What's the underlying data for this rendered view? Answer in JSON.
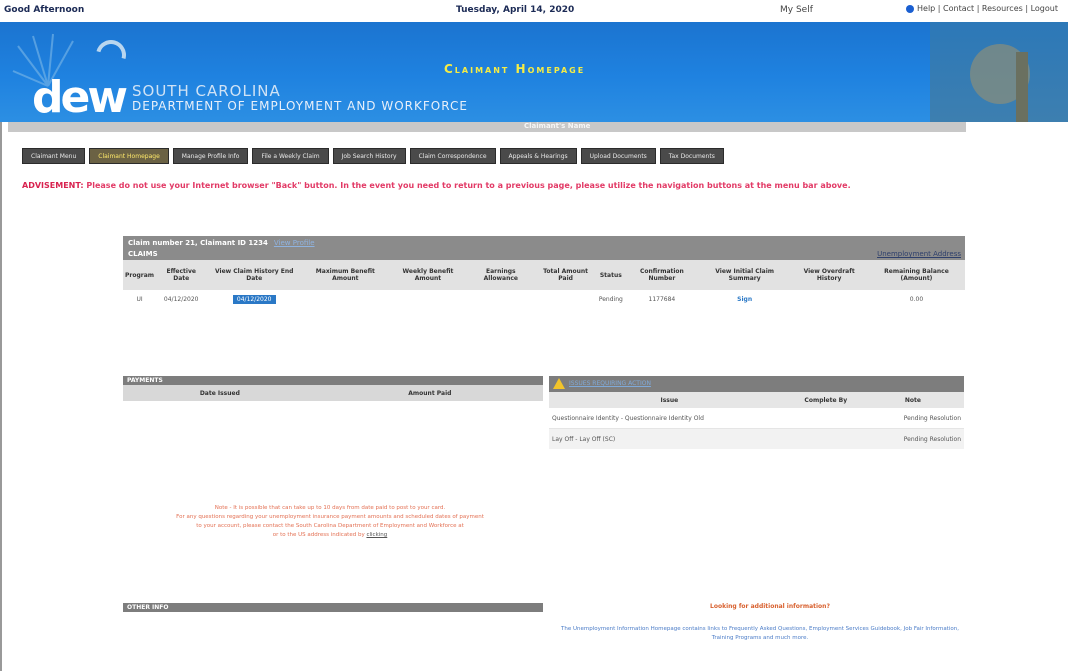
{
  "topbar": {
    "greeting": "Good Afternoon",
    "date": "Tuesday, April 14, 2020",
    "account": "My Self",
    "links": "Help | Contact | Resources | Logout"
  },
  "banner": {
    "logo": "dew",
    "state": "SOUTH CAROLINA",
    "department": "DEPARTMENT OF EMPLOYMENT AND WORKFORCE",
    "page_title": "Claimant Homepage",
    "claimant_name": "Claimant's Name"
  },
  "nav": {
    "tabs": [
      "Claimant Menu",
      "Claimant Homepage",
      "Manage Profile Info",
      "File a Weekly Claim",
      "Job Search History",
      "Claim Correspondence",
      "Appeals & Hearings",
      "Upload Documents",
      "Tax Documents"
    ]
  },
  "advice": {
    "label": "ADVISEMENT:",
    "text": "Please do not use your Internet browser \"Back\" button. In the event you need to return to a previous page, please utilize the navigation buttons at the menu bar above."
  },
  "claims": {
    "header_line1": "Claim number 21, Claimant ID 1234",
    "header_link": "View Profile",
    "header_line2": "CLAIMS",
    "right_link": "Unemployment Address",
    "columns": [
      "Program",
      "Effective Date",
      "View Claim History End Date",
      "Maximum Benefit Amount",
      "Weekly Benefit Amount",
      "Earnings Allowance",
      "Total Amount Paid",
      "Status",
      "Confirmation Number",
      "View Initial Claim Summary",
      "View Overdraft History",
      "Remaining Balance (Amount)"
    ],
    "row": {
      "program": "UI",
      "effective_date": "04/12/2020",
      "history_button": "04/12/2020",
      "max_benefit": "",
      "weekly_benefit": "",
      "earnings": "",
      "total_paid": "",
      "status": "Pending",
      "confirmation": "1177684",
      "summary_link": "Sign",
      "overdraft": "",
      "remaining": "0.00"
    }
  },
  "payments": {
    "title": "PAYMENTS",
    "columns": [
      "Date Issued",
      "",
      "Amount Paid",
      ""
    ]
  },
  "issues": {
    "title": "ISSUES REQUIRING ACTION",
    "columns": [
      "Issue",
      "Complete By",
      "Note"
    ],
    "rows": [
      {
        "issue": "Questionnaire Identity - Questionnaire Identity Old",
        "complete_by": "",
        "note": "Pending Resolution"
      },
      {
        "issue": "Lay Off - Lay Off (SC)",
        "complete_by": "",
        "note": "Pending Resolution"
      }
    ]
  },
  "footnote": {
    "line1": "Note - It is possible that can take up to 10 days from date paid to post to your card.",
    "line2": "For any questions regarding your unemployment insurance payment amounts and scheduled dates of payment",
    "line3": "to your account, please contact the South Carolina Department of Employment and Workforce at",
    "line4": "or to the US address indicated by",
    "link": "clicking"
  },
  "other": {
    "title": "OTHER INFO"
  },
  "looking": {
    "question": "Looking for additional information?",
    "desc": "The Unemployment Information Homepage contains links to Frequently Asked Questions, Employment Services Guidebook, Job Fair Information, Training Programs and much more."
  }
}
